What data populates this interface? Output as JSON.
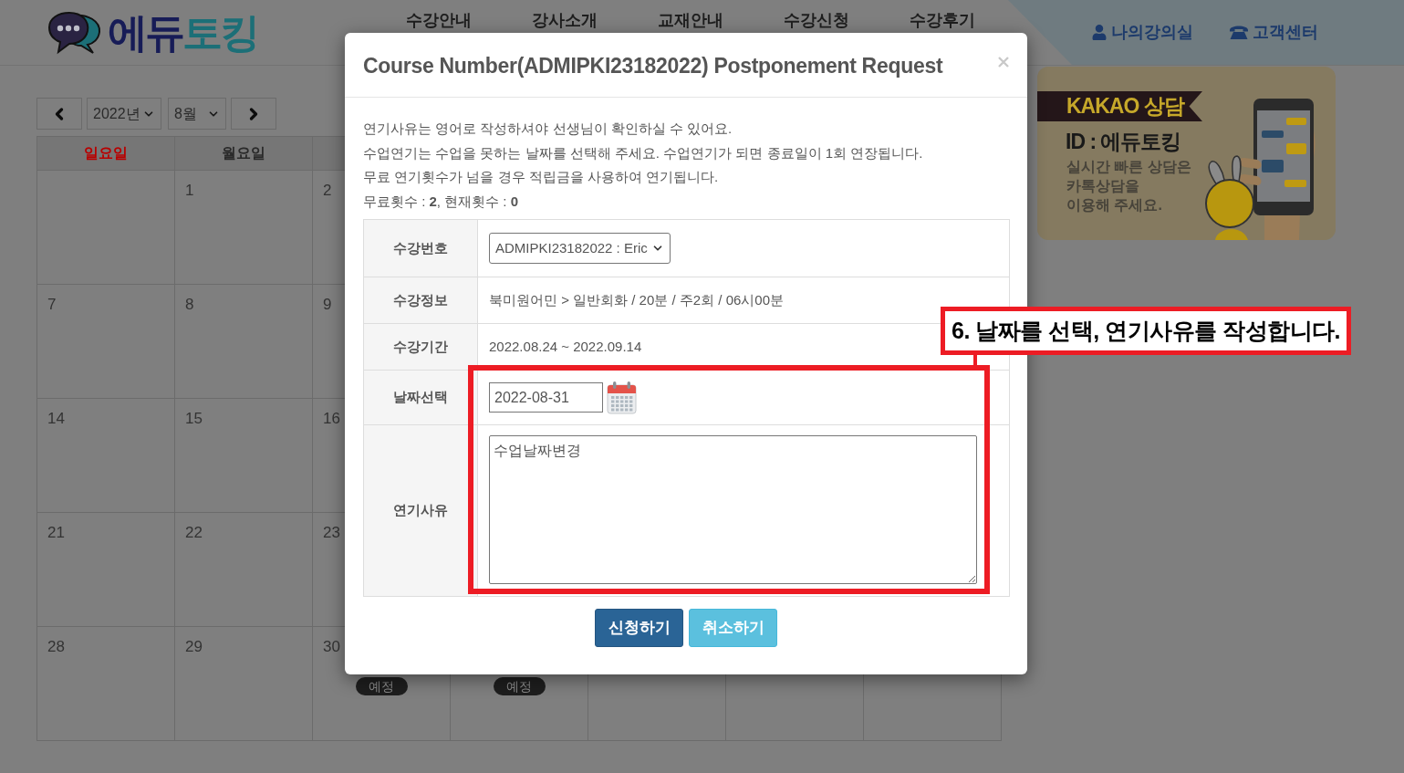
{
  "header": {
    "logo": [
      {
        "text": "에듀",
        "color": "#171c57"
      },
      {
        "text": "토킹",
        "color": "#1c6f77"
      }
    ],
    "nav": [
      "수강안내",
      "강사소개",
      "교재안내",
      "수강신청",
      "수강후기"
    ],
    "user_links": [
      {
        "kind": "person",
        "label": "나의강의실"
      },
      {
        "kind": "phone",
        "label": "고객센터"
      }
    ]
  },
  "calendar": {
    "year": "2022년",
    "month": "8월",
    "weekdays": [
      {
        "label": "일요일",
        "kind": "sunday"
      },
      {
        "label": "월요일",
        "kind": "weekday"
      }
    ],
    "weeks": [
      {
        "cells": [
          {
            "kind": "blank"
          },
          {
            "kind": "day",
            "day": "1"
          },
          {
            "kind": "day",
            "day": "2"
          }
        ]
      },
      {
        "cells": [
          {
            "kind": "day",
            "day": "7"
          },
          {
            "kind": "day",
            "day": "8"
          },
          {
            "kind": "day",
            "day": "9"
          }
        ]
      },
      {
        "cells": [
          {
            "kind": "day",
            "day": "14"
          },
          {
            "kind": "day",
            "day": "15"
          },
          {
            "kind": "day",
            "day": "16"
          }
        ]
      },
      {
        "cells": [
          {
            "kind": "day",
            "day": "21"
          },
          {
            "kind": "day",
            "day": "22"
          },
          {
            "kind": "day",
            "day": "23"
          }
        ]
      },
      {
        "cells": [
          {
            "kind": "day",
            "day": "28"
          },
          {
            "kind": "day",
            "day": "29"
          },
          {
            "kind": "day",
            "day": "30",
            "badge": "예정"
          },
          {
            "kind": "day",
            "badge": "예정"
          },
          {
            "kind": "blank"
          },
          {
            "kind": "blank"
          },
          {
            "kind": "blank"
          }
        ]
      }
    ]
  },
  "kakao_banner": {
    "title": "KAKAO 상담",
    "id_line": "ID : 에듀토킹",
    "lines": [
      "실시간 빠른 상담은",
      "카톡상담을",
      "이용해 주세요."
    ]
  },
  "modal": {
    "title": "Course Number(ADMIPKI23182022) Postponement Request",
    "notes": [
      "연기사유는 영어로 작성하셔야 선생님이 확인하실 수 있어요.",
      "수업연기는 수업을 못하는 날짜를 선택해 주세요. 수업연기가 되면 종료일이 1회 연장됩니다.",
      "무료 연기횟수가 넘을 경우 적립금을 사용하여 연기됩니다.",
      "무료횟수 : **2**, 현재횟수 : **0**"
    ],
    "form": [
      {
        "kind": "select",
        "label": "수강번호",
        "value": "ADMIPKI23182022 : Eric"
      },
      {
        "kind": "text",
        "label": "수강정보",
        "value": "북미원어민 > 일반회화 / 20분 / 주2회 / 06시00분"
      },
      {
        "kind": "text",
        "label": "수강기간",
        "value": "2022.08.24 ~ 2022.09.14"
      },
      {
        "kind": "date",
        "label": "날짜선택",
        "value": "2022-08-31"
      },
      {
        "kind": "textarea",
        "label": "연기사유",
        "value": "수업날짜변경"
      }
    ],
    "buttons": [
      {
        "kind": "primary",
        "label": "신청하기"
      },
      {
        "kind": "info",
        "label": "취소하기"
      }
    ]
  },
  "annotation": {
    "label": "6. 날짜를 선택, 연기사유를 작성합니다."
  }
}
